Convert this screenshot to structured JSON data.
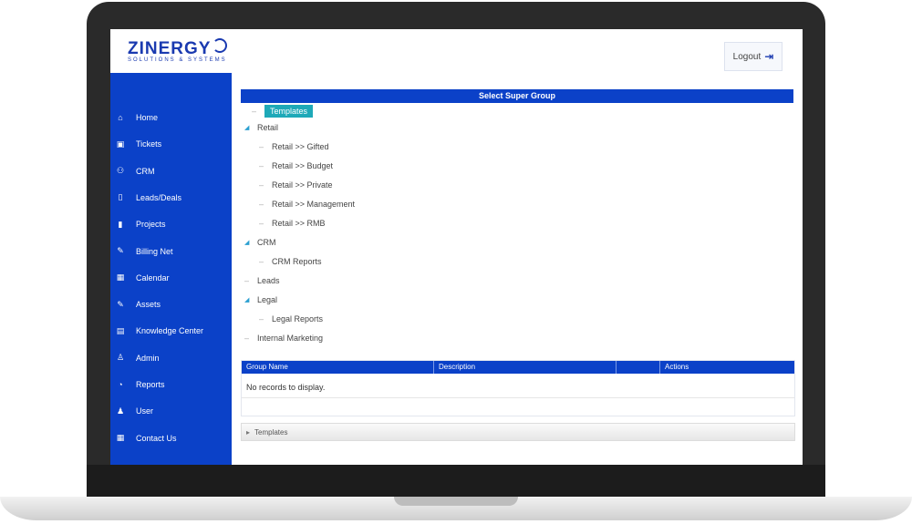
{
  "app": {
    "logo_text": "ZINERGY",
    "logo_sub": "SOLUTIONS & SYSTEMS",
    "logout_label": "Logout"
  },
  "sidebar": {
    "items": [
      {
        "label": "Home",
        "icon": "home-icon",
        "glyph": "⌂"
      },
      {
        "label": "Tickets",
        "icon": "ticket-icon",
        "glyph": "▣"
      },
      {
        "label": "CRM",
        "icon": "users-icon",
        "glyph": "⚇"
      },
      {
        "label": "Leads/Deals",
        "icon": "phone-icon",
        "glyph": "▯"
      },
      {
        "label": "Projects",
        "icon": "project-icon",
        "glyph": "▮"
      },
      {
        "label": "Billing Net",
        "icon": "billing-icon",
        "glyph": "✎"
      },
      {
        "label": "Calendar",
        "icon": "calendar-icon",
        "glyph": "▦"
      },
      {
        "label": "Assets",
        "icon": "assets-icon",
        "glyph": "✎"
      },
      {
        "label": "Knowledge Center",
        "icon": "book-icon",
        "glyph": "▤"
      },
      {
        "label": "Admin",
        "icon": "admin-icon",
        "glyph": "♙"
      },
      {
        "label": "Reports",
        "icon": "reports-icon",
        "glyph": "◔"
      },
      {
        "label": "User",
        "icon": "user-icon",
        "glyph": "♟"
      },
      {
        "label": "Contact Us",
        "icon": "contact-icon",
        "glyph": "▦"
      }
    ]
  },
  "panel": {
    "title": "Select Super Group",
    "selected_root": "Templates",
    "tree": [
      {
        "label": "Retail",
        "level": 0,
        "expanded": true
      },
      {
        "label": "Retail >> Gifted",
        "level": 1
      },
      {
        "label": "Retail >> Budget",
        "level": 1
      },
      {
        "label": "Retail >> Private",
        "level": 1
      },
      {
        "label": "Retail >> Management",
        "level": 1
      },
      {
        "label": "Retail >> RMB",
        "level": 1
      },
      {
        "label": "CRM",
        "level": 0,
        "expanded": true
      },
      {
        "label": "CRM Reports",
        "level": 1
      },
      {
        "label": "Leads",
        "level": 0,
        "expanded": false
      },
      {
        "label": "Legal",
        "level": 0,
        "expanded": true
      },
      {
        "label": "Legal Reports",
        "level": 1
      },
      {
        "label": "Internal Marketing",
        "level": 0,
        "expanded": false
      }
    ]
  },
  "table": {
    "columns": [
      "Group Name",
      "Description",
      "",
      "Actions"
    ],
    "empty_message": "No records to display."
  },
  "footer": {
    "label": "Templates"
  }
}
